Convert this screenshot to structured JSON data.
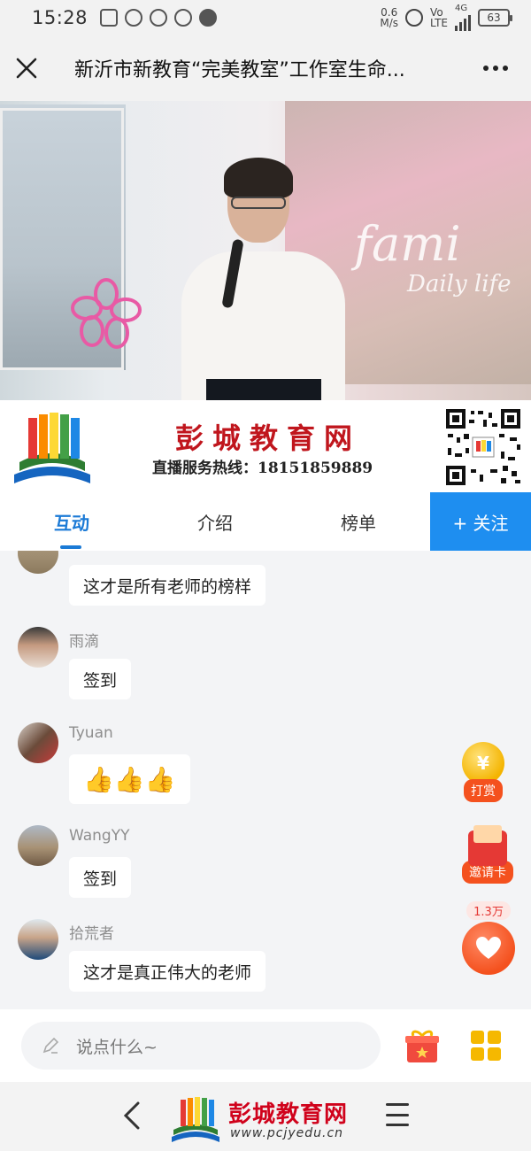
{
  "status": {
    "time": "15:28",
    "net_speed_value": "0.6",
    "net_speed_unit": "M/s",
    "volte_top": "Vo",
    "volte_bottom": "LTE",
    "network": "4G",
    "battery": "63"
  },
  "header": {
    "title": "新沂市新教育“完美教室”工作室生命...",
    "close_icon": "close-icon",
    "more_icon": "more-dots-icon"
  },
  "video": {
    "script_text_1": "fami",
    "script_text_2": "Daily life"
  },
  "banner": {
    "site_name": "彭城教育网",
    "hotline": "直播服务热线：18151859889"
  },
  "tabs": [
    {
      "label": "互动",
      "active": true
    },
    {
      "label": "介绍",
      "active": false
    },
    {
      "label": "榜单",
      "active": false
    }
  ],
  "follow_button": "+ 关注",
  "messages": [
    {
      "user": "",
      "text": "这才是所有老师的榜样"
    },
    {
      "user": "雨滴",
      "text": "签到"
    },
    {
      "user": "Tyuan",
      "text": "👍👍👍"
    },
    {
      "user": "WangYY",
      "text": "签到"
    },
    {
      "user": "拾荒者",
      "text": "这才是真正伟大的老师"
    }
  ],
  "side_actions": {
    "reward_symbol": "¥",
    "reward_label": "打赏",
    "invite_label": "邀请卡",
    "like_count": "1.3万"
  },
  "input": {
    "placeholder": "说点什么~"
  },
  "watermark": {
    "name": "彭城教育网",
    "url": "www.pcjyedu.cn"
  },
  "colors": {
    "accent": "#1b7ad6",
    "follow_bg": "#1e8ef0",
    "brand_red": "#c0161d"
  }
}
